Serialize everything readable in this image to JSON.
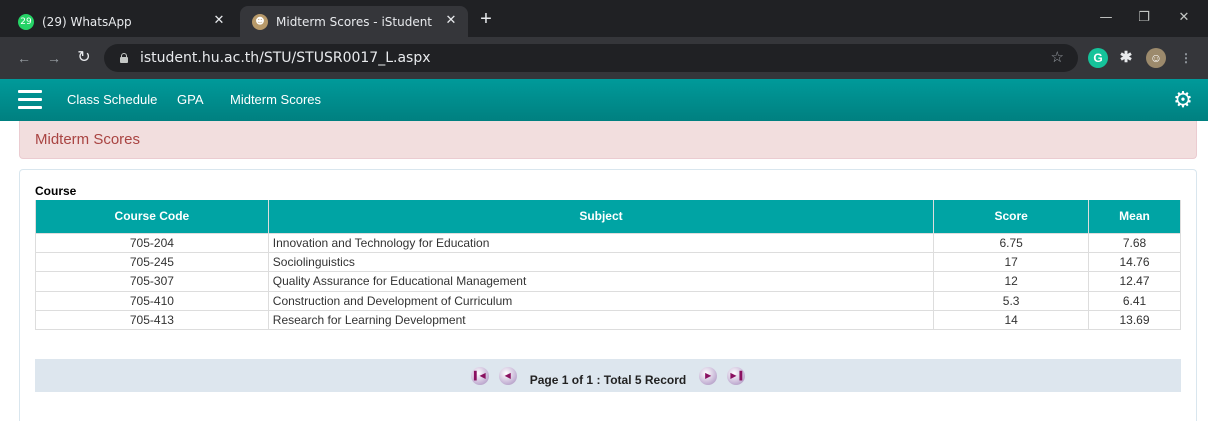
{
  "browser": {
    "tabs": [
      {
        "title": "(29) WhatsApp",
        "favicon": "whatsapp-icon",
        "active": false
      },
      {
        "title": "Midterm Scores - iStudent",
        "favicon": "istudent-icon",
        "active": true
      }
    ],
    "url": "istudent.hu.ac.th/STU/STUSR0017_L.aspx"
  },
  "nav": {
    "links": [
      "Class Schedule",
      "GPA",
      "Midterm Scores"
    ]
  },
  "page": {
    "heading": "Midterm Scores",
    "section_title": "Course"
  },
  "table": {
    "headers": [
      "Course Code",
      "Subject",
      "Score",
      "Mean"
    ],
    "rows": [
      [
        "705-204",
        "Innovation and Technology for Education",
        "6.75",
        "7.68"
      ],
      [
        "705-245",
        "Sociolinguistics",
        "17",
        "14.76"
      ],
      [
        "705-307",
        "Quality Assurance for Educational Management",
        "12",
        "12.47"
      ],
      [
        "705-410",
        "Construction and Development of Curriculum",
        "5.3",
        "6.41"
      ],
      [
        "705-413",
        "Research for Learning Development",
        "14",
        "13.69"
      ]
    ]
  },
  "pager": {
    "info": "Page 1 of 1 : Total 5 Record"
  },
  "colors": {
    "nav_bg": "#008b8b",
    "header_bg": "#00a4a4",
    "alert_text": "#a94442",
    "alert_bg": "#f2dede"
  }
}
